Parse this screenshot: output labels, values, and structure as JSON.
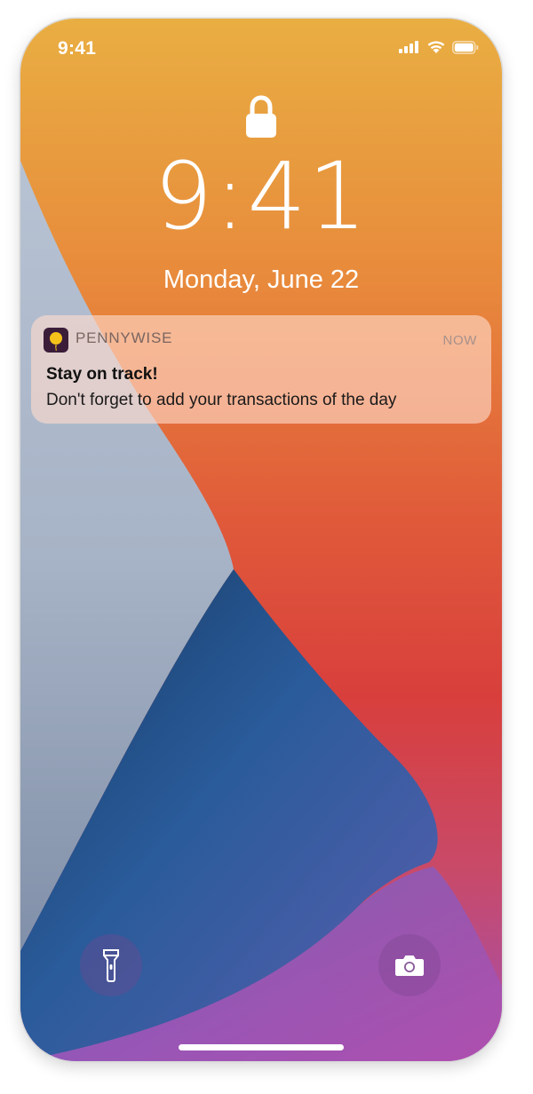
{
  "status_bar": {
    "time": "9:41"
  },
  "lock_screen": {
    "time": "9:41",
    "date": "Monday, June 22"
  },
  "notification": {
    "app_name": "PENNYWISE",
    "timestamp": "NOW",
    "title": "Stay on track!",
    "body": "Don't forget to add your transactions of the day",
    "app_icon_color": "#3b1d3a",
    "app_icon_accent": "#f4c21b"
  },
  "icons": {
    "lock": "lock-icon",
    "signal": "cellular-signal-icon",
    "wifi": "wifi-icon",
    "battery": "battery-icon",
    "flashlight": "flashlight-icon",
    "camera": "camera-icon"
  }
}
